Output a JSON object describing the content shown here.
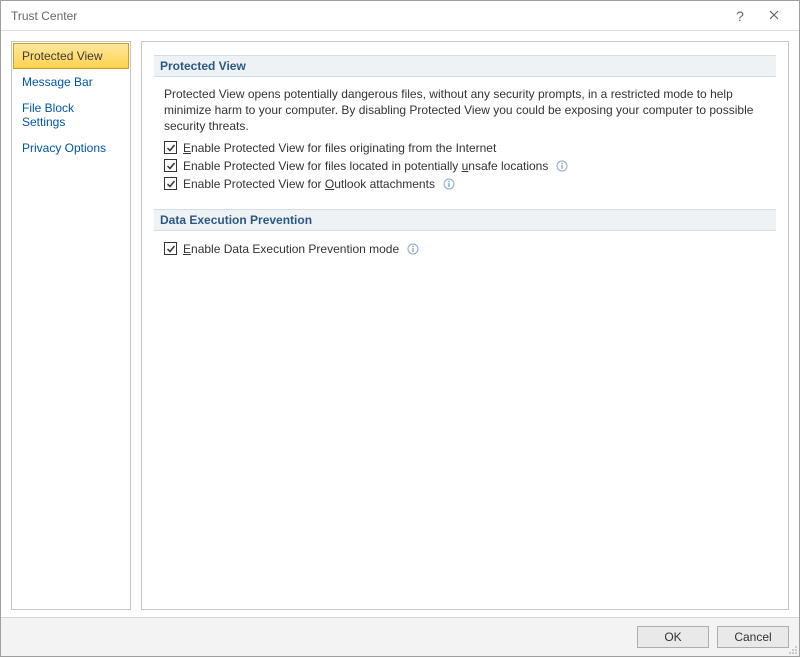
{
  "dialog": {
    "title": "Trust Center"
  },
  "sidebar": {
    "items": [
      {
        "label": "Protected View",
        "selected": true
      },
      {
        "label": "Message Bar",
        "selected": false
      },
      {
        "label": "File Block Settings",
        "selected": false
      },
      {
        "label": "Privacy Options",
        "selected": false
      }
    ]
  },
  "sections": {
    "protected_view": {
      "heading": "Protected View",
      "description": "Protected View opens potentially dangerous files, without any security prompts, in a restricted mode to help minimize harm to your computer. By disabling Protected View you could be exposing your computer to possible security threats.",
      "checks": [
        {
          "label_pre": "",
          "accel": "E",
          "label_post": "nable Protected View for files originating from the Internet",
          "checked": true,
          "info": false
        },
        {
          "label_pre": "Enable Protected View for files located in potentially ",
          "accel": "u",
          "label_post": "nsafe locations",
          "checked": true,
          "info": true
        },
        {
          "label_pre": "Enable Protected View for ",
          "accel": "O",
          "label_post": "utlook attachments",
          "checked": true,
          "info": true
        }
      ]
    },
    "dep": {
      "heading": "Data Execution Prevention",
      "checks": [
        {
          "label_pre": "",
          "accel": "E",
          "label_post": "nable Data Execution Prevention mode",
          "checked": true,
          "info": true
        }
      ]
    }
  },
  "footer": {
    "ok": "OK",
    "cancel": "Cancel"
  }
}
